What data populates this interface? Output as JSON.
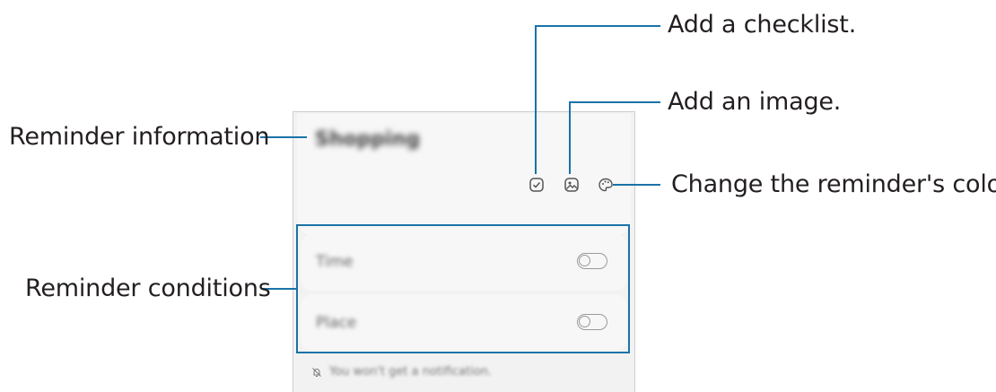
{
  "callouts": {
    "add_checklist": "Add a checklist.",
    "add_image": "Add an image.",
    "reminder_information": "Reminder information",
    "change_color": "Change the reminder's color.",
    "reminder_conditions": "Reminder conditions"
  },
  "reminder": {
    "title": "Shopping",
    "conditions": [
      {
        "label": "Time",
        "enabled": false
      },
      {
        "label": "Place",
        "enabled": false
      }
    ],
    "notice": "You won't get a notification."
  },
  "icons": {
    "checklist": "checklist-icon",
    "image": "image-icon",
    "palette": "palette-icon",
    "notice": "bell-off-icon"
  },
  "colors": {
    "callout_line": "#1a73a8",
    "text": "#231f20",
    "panel_bg": "#f2f2f2"
  }
}
